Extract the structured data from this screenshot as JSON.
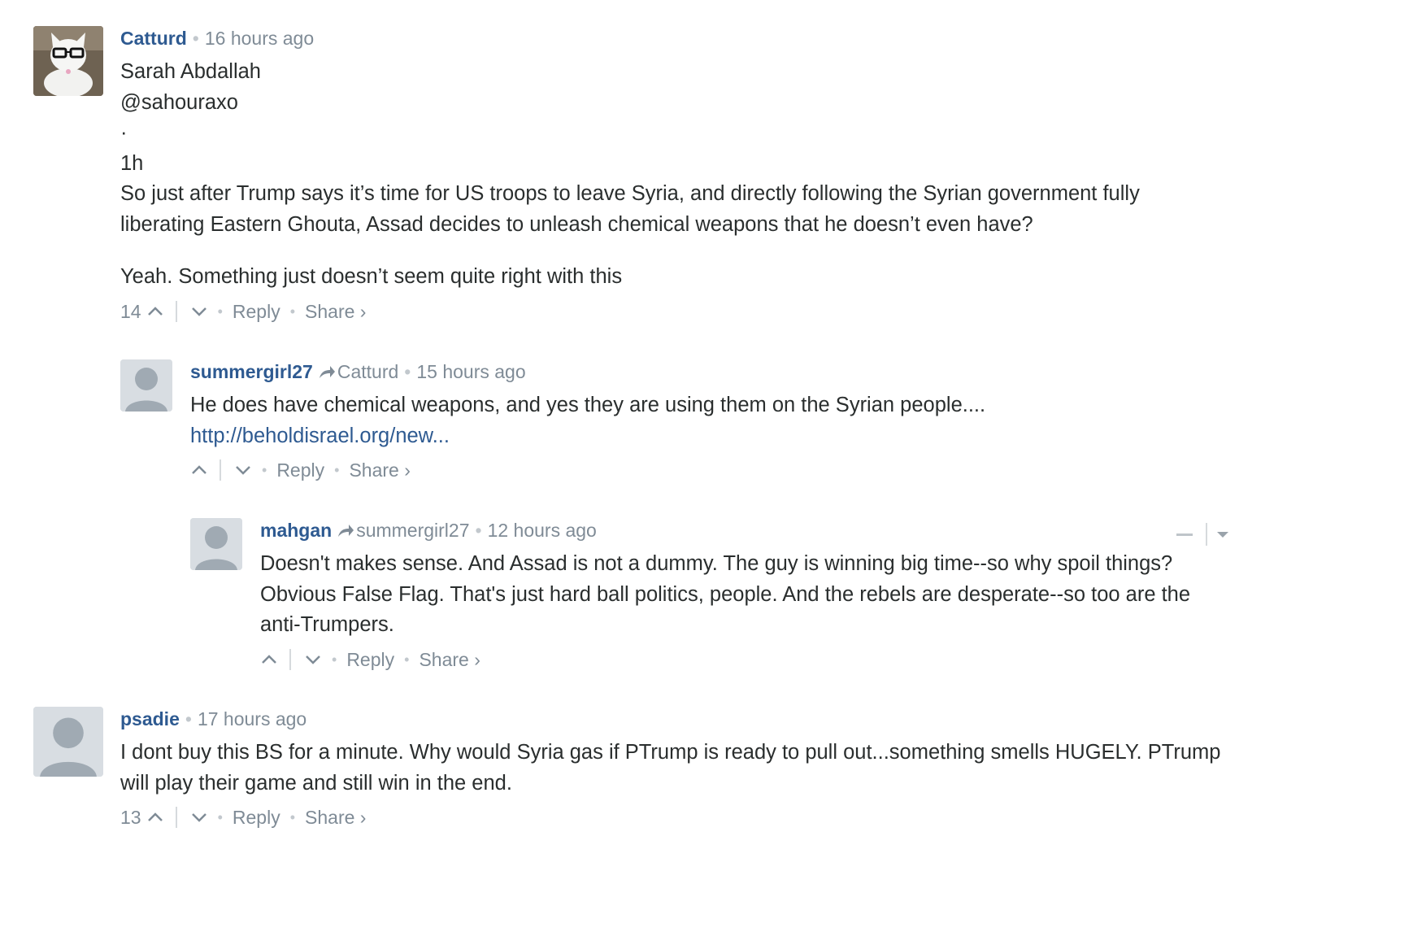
{
  "colors": {
    "author": "#2e5a91",
    "meta": "#7f8b96",
    "text": "#2a2e2e",
    "avatar_bg": "#d8dde2"
  },
  "comments": [
    {
      "author": "Catturd",
      "time": "16 hours ago",
      "avatar_icon": "cat-with-glasses-avatar",
      "lines": [
        "Sarah Abdallah",
        "@sahouraxo",
        "·",
        "1h",
        "So just after Trump says it’s time for US troops to leave Syria, and directly following the Syrian government fully liberating Eastern Ghouta, Assad decides to unleash chemical weapons that he doesn’t even have?"
      ],
      "paragraph2": "Yeah. Something just doesn’t seem quite right with this",
      "votes": "14",
      "reply_label": "Reply",
      "share_label": "Share ›"
    },
    {
      "author": "summergirl27",
      "parent": "Catturd",
      "time": "15 hours ago",
      "avatar_icon": "default-user-avatar",
      "text": "He does have chemical weapons, and yes they are using them on the Syrian people....",
      "link": "http://beholdisrael.org/new...",
      "reply_label": "Reply",
      "share_label": "Share ›"
    },
    {
      "author": "mahgan",
      "parent": "summergirl27",
      "time": "12 hours ago",
      "avatar_icon": "default-user-avatar",
      "text": "Doesn't makes sense. And Assad is not a dummy. The guy is winning big time--so why spoil things? Obvious False Flag. That's just hard ball politics, people. And the rebels are desperate--so too are the anti-Trumpers.",
      "reply_label": "Reply",
      "share_label": "Share ›"
    },
    {
      "author": "psadie",
      "time": "17 hours ago",
      "avatar_icon": "default-user-avatar",
      "text": "I dont buy this BS for a minute. Why would Syria gas if PTrump is ready to pull out...something smells HUGELY. PTrump will play their game and still win in the end.",
      "votes": "13",
      "reply_label": "Reply",
      "share_label": "Share ›"
    }
  ]
}
